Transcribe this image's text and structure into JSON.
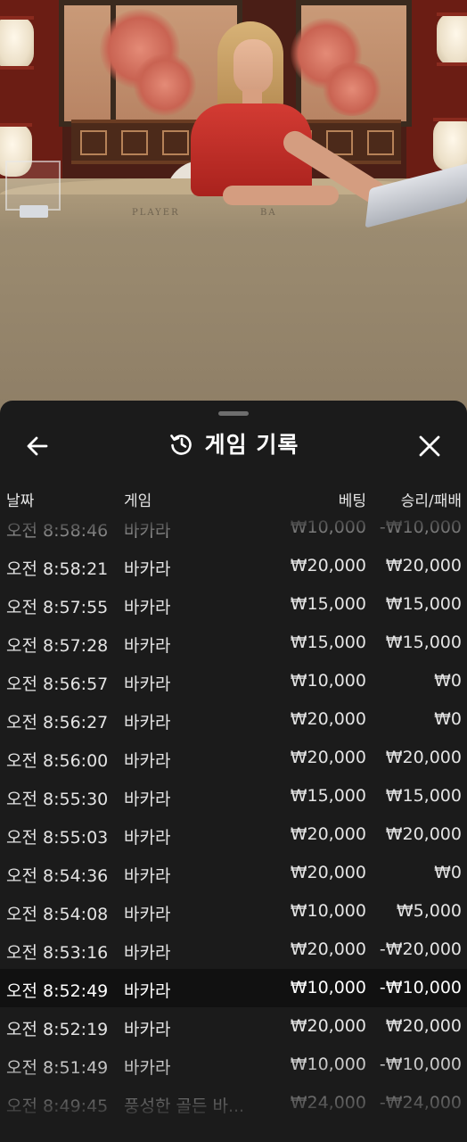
{
  "header": {
    "title": "게임 기록",
    "icons": {
      "back": "arrow-left-icon",
      "history": "history-icon",
      "close": "close-icon"
    }
  },
  "columns": {
    "date": "날짜",
    "game": "게임",
    "bet": "베팅",
    "result": "승리/패배"
  },
  "table_text": {
    "player": "PLAYER",
    "banker": "BA"
  },
  "rows": [
    {
      "time": "오전 8:58:46",
      "game": "바카라",
      "bet": "₩10,000",
      "result": "-₩10,000"
    },
    {
      "time": "오전 8:58:21",
      "game": "바카라",
      "bet": "₩20,000",
      "result": "₩20,000"
    },
    {
      "time": "오전 8:57:55",
      "game": "바카라",
      "bet": "₩15,000",
      "result": "₩15,000"
    },
    {
      "time": "오전 8:57:28",
      "game": "바카라",
      "bet": "₩15,000",
      "result": "₩15,000"
    },
    {
      "time": "오전 8:56:57",
      "game": "바카라",
      "bet": "₩10,000",
      "result": "₩0"
    },
    {
      "time": "오전 8:56:27",
      "game": "바카라",
      "bet": "₩20,000",
      "result": "₩0"
    },
    {
      "time": "오전 8:56:00",
      "game": "바카라",
      "bet": "₩20,000",
      "result": "₩20,000"
    },
    {
      "time": "오전 8:55:30",
      "game": "바카라",
      "bet": "₩15,000",
      "result": "₩15,000"
    },
    {
      "time": "오전 8:55:03",
      "game": "바카라",
      "bet": "₩20,000",
      "result": "₩20,000"
    },
    {
      "time": "오전 8:54:36",
      "game": "바카라",
      "bet": "₩20,000",
      "result": "₩0"
    },
    {
      "time": "오전 8:54:08",
      "game": "바카라",
      "bet": "₩10,000",
      "result": "₩5,000"
    },
    {
      "time": "오전 8:53:16",
      "game": "바카라",
      "bet": "₩20,000",
      "result": "-₩20,000"
    },
    {
      "time": "오전 8:52:49",
      "game": "바카라",
      "bet": "₩10,000",
      "result": "-₩10,000"
    },
    {
      "time": "오전 8:52:19",
      "game": "바카라",
      "bet": "₩20,000",
      "result": "₩20,000"
    },
    {
      "time": "오전 8:51:49",
      "game": "바카라",
      "bet": "₩10,000",
      "result": "-₩10,000"
    },
    {
      "time": "오전 8:49:45",
      "game": "풍성한 골든 바...",
      "bet": "₩24,000",
      "result": "-₩24,000"
    }
  ],
  "colors": {
    "sheet_bg": "#1b1b1b",
    "highlight_row": "#111111",
    "text": "#ffffff"
  }
}
